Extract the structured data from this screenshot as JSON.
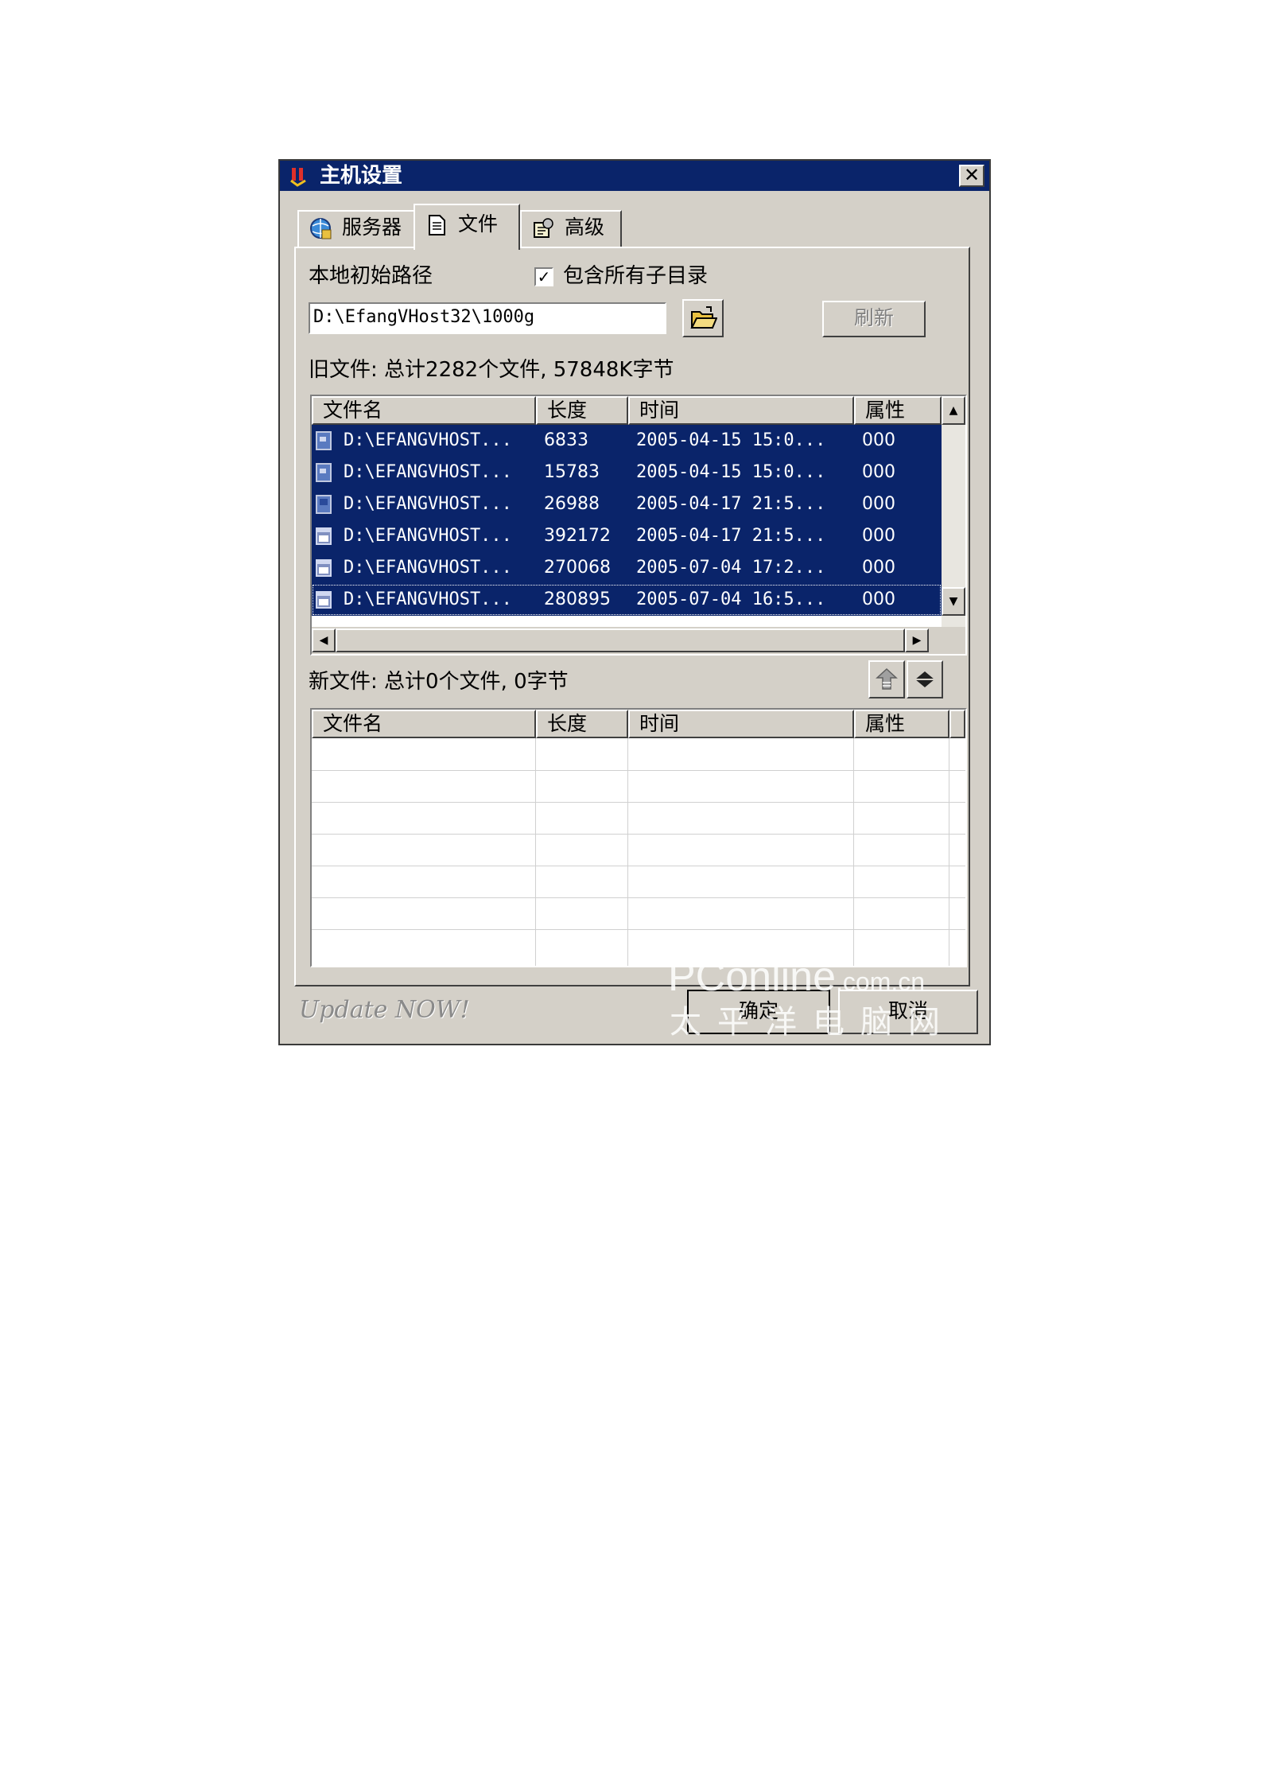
{
  "window": {
    "title": "主机设置",
    "close_glyph": "✕"
  },
  "tabs": [
    {
      "label": "服务器",
      "icon": "globe-server-icon"
    },
    {
      "label": "文件",
      "icon": "document-icon",
      "active": true
    },
    {
      "label": "高级",
      "icon": "advanced-settings-icon"
    }
  ],
  "local_path": {
    "label": "本地初始路径",
    "include_subdirs_label": "包含所有子目录",
    "include_subdirs_checked": true,
    "value": "D:\\EfangVHost32\\1000g",
    "browse_icon": "open-folder-icon",
    "refresh_label": "刷新"
  },
  "old_files": {
    "summary": "旧文件: 总计2282个文件, 57848K字节",
    "columns": [
      "文件名",
      "长度",
      "时间",
      "属性"
    ],
    "rows": [
      {
        "name": "D:\\EFANGVHOST...",
        "size": "6833",
        "time": "2005-04-15 15:0...",
        "attr": "000",
        "icon": "file-icon"
      },
      {
        "name": "D:\\EFANGVHOST...",
        "size": "15783",
        "time": "2005-04-15 15:0...",
        "attr": "000",
        "icon": "file-icon"
      },
      {
        "name": "D:\\EFANGVHOST...",
        "size": "26988",
        "time": "2005-04-17 21:5...",
        "attr": "000",
        "icon": "file-icon"
      },
      {
        "name": "D:\\EFANGVHOST...",
        "size": "392172",
        "time": "2005-04-17 21:5...",
        "attr": "000",
        "icon": "window-file-icon"
      },
      {
        "name": "D:\\EFANGVHOST...",
        "size": "270068",
        "time": "2005-07-04 17:2...",
        "attr": "000",
        "icon": "window-file-icon"
      },
      {
        "name": "D:\\EFANGVHOST...",
        "size": "280895",
        "time": "2005-07-04 16:5...",
        "attr": "000",
        "icon": "window-file-icon"
      }
    ]
  },
  "new_files": {
    "summary": "新文件: 总计0个文件, 0字节",
    "move_up_icon": "move-up-icon",
    "move_down_icon": "move-down-icon",
    "columns": [
      "文件名",
      "长度",
      "时间",
      "属性"
    ]
  },
  "footer": {
    "tagline": "Update NOW!",
    "ok_label": "确定",
    "cancel_label": "取消"
  },
  "watermark": {
    "logo": "PConline",
    "domain": ".com.cn",
    "cn": "太平洋电脑网"
  },
  "colors": {
    "titlebar": "#0a246a",
    "selection": "#0a246a",
    "face": "#d4d0c8"
  }
}
